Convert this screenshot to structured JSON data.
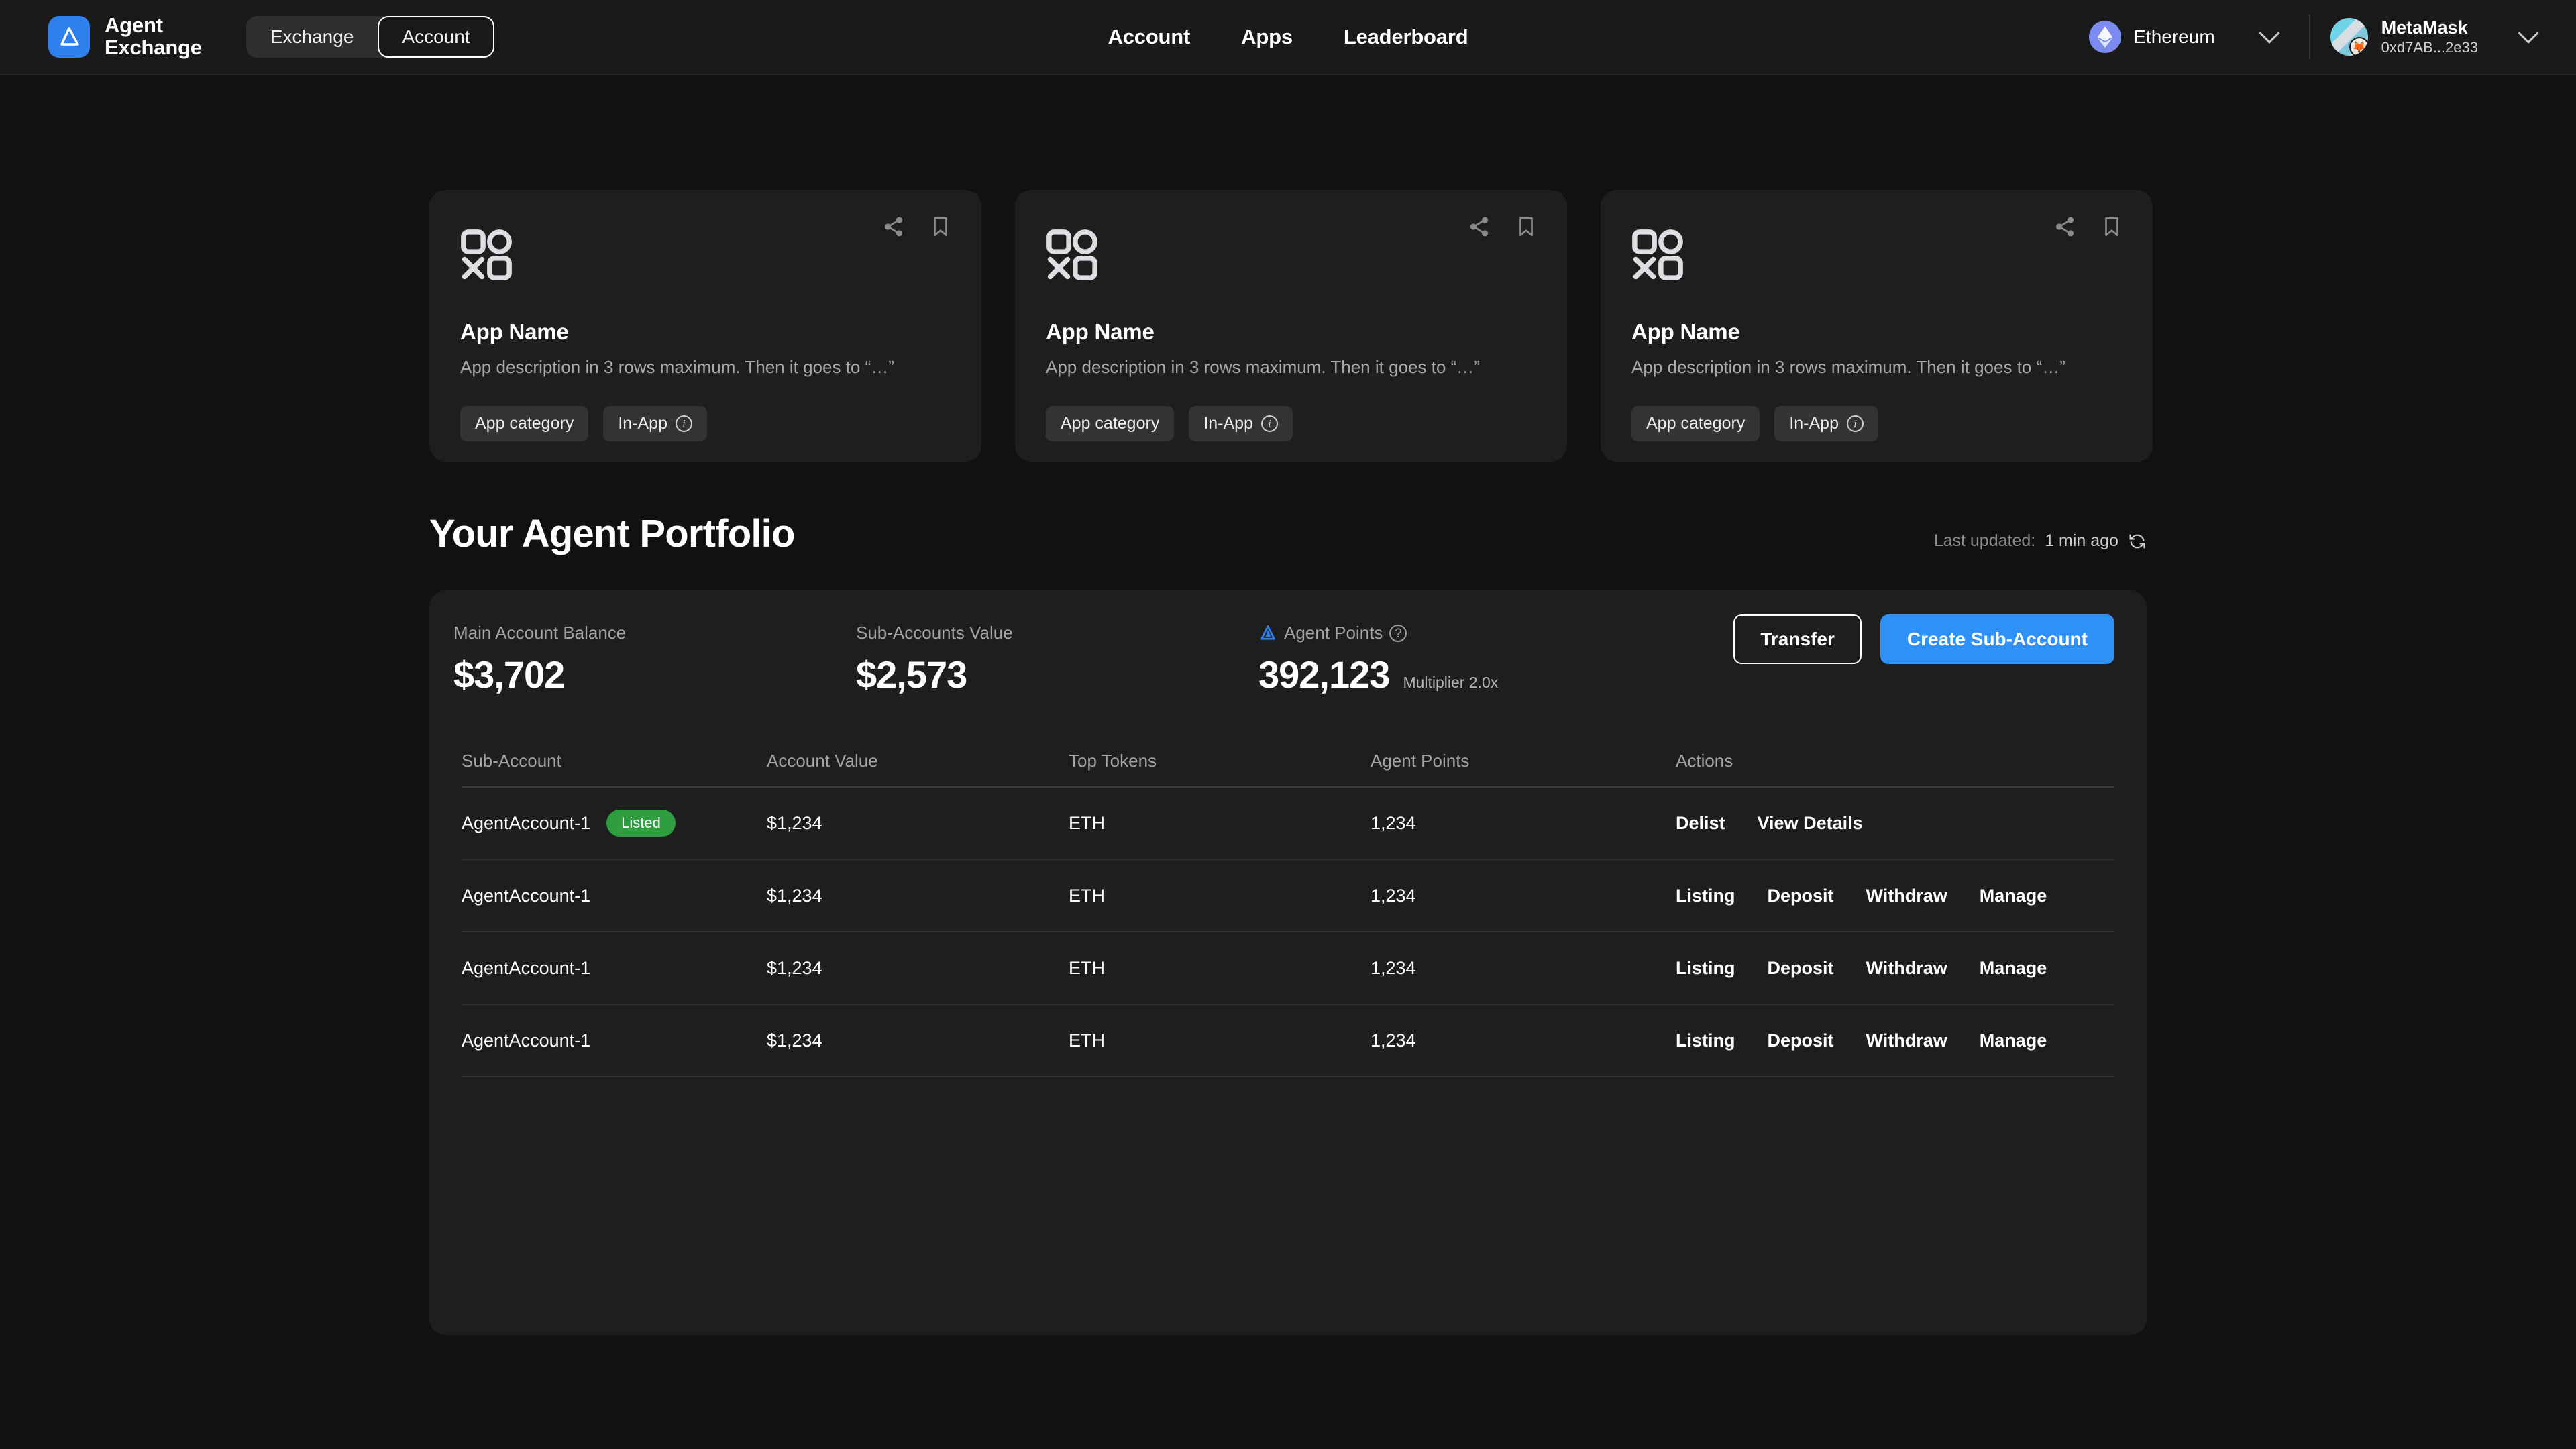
{
  "header": {
    "brand_name": "Agent\nExchange",
    "logo_icon": "agent-exchange-logo",
    "segmented": [
      {
        "label": "Exchange",
        "active": false
      },
      {
        "label": "Account",
        "active": true
      }
    ],
    "nav": [
      {
        "label": "Account"
      },
      {
        "label": "Apps"
      },
      {
        "label": "Leaderboard"
      }
    ],
    "chain": {
      "name": "Ethereum",
      "icon": "ethereum-icon",
      "chevron_icon": "chevron-down-icon"
    },
    "wallet": {
      "name": "MetaMask",
      "address": "0xd7AB...2e33",
      "avatar_icon": "wallet-avatar",
      "fox_icon": "metamask-fox-icon",
      "chevron_icon": "chevron-down-icon"
    }
  },
  "app_cards": [
    {
      "glyph_icon": "app-grid-icon",
      "share_icon": "share-icon",
      "bookmark_icon": "bookmark-icon",
      "name": "App Name",
      "description": "App description in 3 rows maximum. Then it goes to “…”",
      "chips": [
        {
          "label": "App category",
          "info": false
        },
        {
          "label": "In-App",
          "info": true,
          "info_icon": "info-icon"
        }
      ]
    },
    {
      "glyph_icon": "app-grid-icon",
      "share_icon": "share-icon",
      "bookmark_icon": "bookmark-icon",
      "name": "App Name",
      "description": "App description in 3 rows maximum. Then it goes to “…”",
      "chips": [
        {
          "label": "App category",
          "info": false
        },
        {
          "label": "In-App",
          "info": true,
          "info_icon": "info-icon"
        }
      ]
    },
    {
      "glyph_icon": "app-grid-icon",
      "share_icon": "share-icon",
      "bookmark_icon": "bookmark-icon",
      "name": "App Name",
      "description": "App description in 3 rows maximum. Then it goes to “…”",
      "chips": [
        {
          "label": "App category",
          "info": false
        },
        {
          "label": "In-App",
          "info": true,
          "info_icon": "info-icon"
        }
      ]
    }
  ],
  "portfolio": {
    "title": "Your Agent Portfolio",
    "last_updated_label": "Last updated:",
    "last_updated_value": "1 min ago",
    "refresh_icon": "refresh-icon",
    "stats": [
      {
        "label": "Main Account Balance",
        "value": "$3,702",
        "sub": ""
      },
      {
        "label": "Sub-Accounts Value",
        "value": "$2,573",
        "sub": ""
      },
      {
        "label": "Agent Points",
        "value": "392,123",
        "sub": "Multiplier 2.0x",
        "leading_icon": "agent-points-icon",
        "help_icon": "question-icon"
      }
    ],
    "buttons": {
      "transfer": "Transfer",
      "create_sub_account": "Create Sub-Account"
    },
    "table": {
      "columns": [
        "Sub-Account",
        "Account Value",
        "Top Tokens",
        "Agent Points",
        "Actions"
      ],
      "rows": [
        {
          "sub_account": "AgentAccount-1",
          "badge": "Listed",
          "account_value": "$1,234",
          "top_tokens": "ETH",
          "agent_points": "1,234",
          "actions": [
            "Delist",
            "View Details"
          ]
        },
        {
          "sub_account": "AgentAccount-1",
          "badge": "",
          "account_value": "$1,234",
          "top_tokens": "ETH",
          "agent_points": "1,234",
          "actions": [
            "Listing",
            "Deposit",
            "Withdraw",
            "Manage"
          ]
        },
        {
          "sub_account": "AgentAccount-1",
          "badge": "",
          "account_value": "$1,234",
          "top_tokens": "ETH",
          "agent_points": "1,234",
          "actions": [
            "Listing",
            "Deposit",
            "Withdraw",
            "Manage"
          ]
        },
        {
          "sub_account": "AgentAccount-1",
          "badge": "",
          "account_value": "$1,234",
          "top_tokens": "ETH",
          "agent_points": "1,234",
          "actions": [
            "Listing",
            "Deposit",
            "Withdraw",
            "Manage"
          ]
        }
      ]
    }
  },
  "colors": {
    "page_bg": "#111111",
    "surface": "#1e1e1e",
    "header_bg": "#1a1a1a",
    "accent": "#2f90f5",
    "badge_green": "#2f9e41",
    "text_primary": "#ffffff",
    "text_muted": "#a3a3a3"
  }
}
